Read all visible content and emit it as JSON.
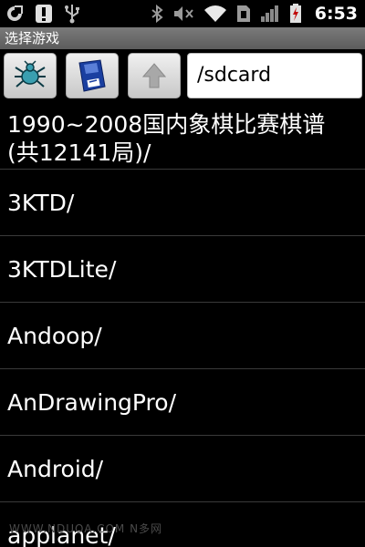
{
  "status_bar": {
    "time": "6:53",
    "icons_left": [
      "sync-icon",
      "alert-icon",
      "usb-icon"
    ],
    "icons_right": [
      "bluetooth-icon",
      "mute-icon",
      "wifi-icon",
      "sim-icon",
      "signal-icon",
      "battery-charging-icon"
    ]
  },
  "title_bar": {
    "title": "选择游戏"
  },
  "toolbar": {
    "path": "/sdcard",
    "buttons": [
      "bug-icon",
      "save-disk-icon",
      "up-arrow-icon"
    ]
  },
  "file_list": {
    "items": [
      "1990~2008国内象棋比赛棋谱(共12141局)/",
      "3KTD/",
      "3KTDLite/",
      "Andoop/",
      "AnDrawingPro/",
      "Android/",
      "applanet/"
    ]
  },
  "watermark": {
    "text": "WWW.NDUOA.COM N多网"
  }
}
